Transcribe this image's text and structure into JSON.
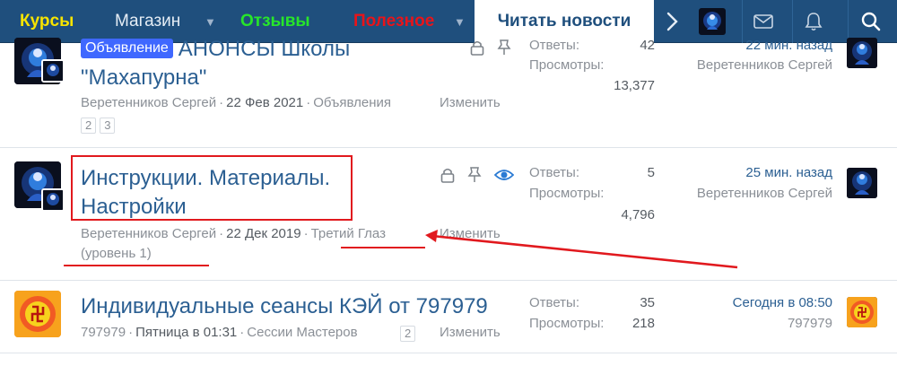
{
  "nav": {
    "items": [
      {
        "label": "Курсы"
      },
      {
        "label": "Магазин"
      },
      {
        "label": "Отзывы"
      },
      {
        "label": "Полезное"
      }
    ],
    "active_tab": "Читать новости",
    "icons": [
      "chevron-right-icon",
      "avatar",
      "mail-icon",
      "bell-icon",
      "search-icon"
    ]
  },
  "threads": [
    {
      "prefix": "Объявление",
      "title": "АНОНСЫ Школы \"Махапурна\"",
      "author": "Веретенников Сергей",
      "date": "22 Фев 2021",
      "forum": "Объявления",
      "edit": "Изменить",
      "pages": [
        "2",
        "3"
      ],
      "replies_label": "Ответы:",
      "replies": "42",
      "views_label": "Просмотры:",
      "views": "13,377",
      "last_time": "22 мин. назад",
      "last_user": "Веретенников Сергей"
    },
    {
      "title": "Инструкции. Материалы. Настройки",
      "author": "Веретенников Сергей",
      "date": "22 Дек 2019",
      "forum": "Третий Глаз (уровень 1)",
      "edit": "Изменить",
      "replies_label": "Ответы:",
      "replies": "5",
      "views_label": "Просмотры:",
      "views": "4,796",
      "last_time": "25 мин. назад",
      "last_user": "Веретенников Сергей"
    },
    {
      "title": "Индивидуальные сеансы КЭЙ от 797979",
      "author": "797979",
      "date": "Пятница в 01:31",
      "forum": "Сессии Мастеров",
      "edit": "Изменить",
      "pages": [
        "2"
      ],
      "replies_label": "Ответы:",
      "replies": "35",
      "views_label": "Просмотры:",
      "views": "218",
      "last_time": "Сегодня в 08:50",
      "last_user": "797979"
    }
  ],
  "colors": {
    "nav_bg": "#1f4f7d",
    "link": "#2b5f92",
    "muted": "#8a8f96",
    "prefix_bg": "#3f68ff",
    "annotation": "#e1191e",
    "nav_kursy": "#f7e400",
    "nav_otzyvy": "#27e62a",
    "nav_poleznoe": "#e8141a"
  }
}
